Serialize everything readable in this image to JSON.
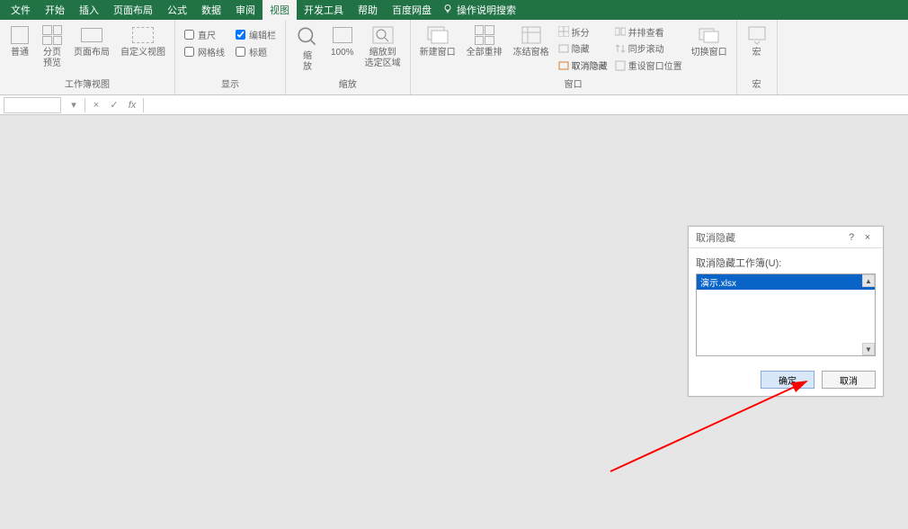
{
  "menu": {
    "items": [
      "文件",
      "开始",
      "插入",
      "页面布局",
      "公式",
      "数据",
      "审阅",
      "视图",
      "开发工具",
      "帮助",
      "百度网盘"
    ],
    "active_index": 7,
    "search_label": "操作说明搜索"
  },
  "ribbon": {
    "groups": {
      "view": {
        "label": "工作簿视图",
        "normal": "普通",
        "preview": "分页\n预览",
        "page_layout": "页面布局",
        "custom_view": "自定义视图"
      },
      "show": {
        "label": "显示",
        "ruler": "直尺",
        "gridlines": "网格线",
        "formula_bar": "编辑栏",
        "headings": "标题",
        "ruler_checked": false,
        "gridlines_checked": false,
        "formula_bar_checked": true,
        "headings_checked": false
      },
      "zoom": {
        "label": "缩放",
        "zoom": "缩\n放",
        "hundred": "100%",
        "to_selection": "缩放到\n选定区域"
      },
      "window": {
        "label": "窗口",
        "new_window": "新建窗口",
        "arrange_all": "全部重排",
        "freeze": "冻结窗格",
        "split": "拆分",
        "hide": "隐藏",
        "unhide": "取消隐藏",
        "view_side": "并排查看",
        "sync_scroll": "同步滚动",
        "reset_pos": "重设窗口位置",
        "switch_window": "切换窗口"
      },
      "macro": {
        "label": "宏",
        "macro": "宏"
      }
    }
  },
  "formula_bar": {
    "name_value": "",
    "fx": "fx"
  },
  "dialog": {
    "title": "取消隐藏",
    "help": "?",
    "close": "×",
    "label": "取消隐藏工作簿(U):",
    "selected_item": "演示.xlsx",
    "ok": "确定",
    "cancel": "取消"
  }
}
